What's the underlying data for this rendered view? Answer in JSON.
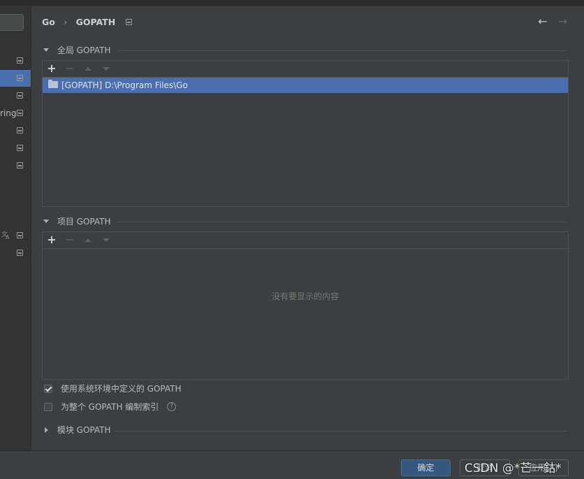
{
  "sidebar": {
    "items": [
      {
        "label": "",
        "selected": false
      },
      {
        "label": "",
        "selected": true
      },
      {
        "label": "",
        "selected": false
      },
      {
        "label": "ring",
        "selected": false
      },
      {
        "label": "",
        "selected": false
      },
      {
        "label": "",
        "selected": false
      },
      {
        "label": "",
        "selected": false
      }
    ],
    "extra_items": [
      {
        "icon": "translate-icon"
      },
      {
        "icon": "project-level-icon"
      }
    ]
  },
  "header": {
    "breadcrumb": [
      "Go",
      "GOPATH"
    ]
  },
  "global_section": {
    "title": "全局 GOPATH",
    "paths": [
      "[GOPATH] D:\\Program Files\\Go"
    ]
  },
  "project_section": {
    "title": "项目 GOPATH",
    "empty_text": "没有要显示的内容"
  },
  "options": {
    "use_system_env": {
      "label": "使用系统环境中定义的 GOPATH",
      "checked": true
    },
    "index_entire": {
      "label": "为整个 GOPATH 编制索引",
      "checked": false
    }
  },
  "module_section": {
    "title": "模块 GOPATH"
  },
  "buttons": {
    "ok": "确定",
    "cancel": "取消",
    "apply": "应用(A)"
  },
  "watermark": "CSDN @*芒一鈷*",
  "colors": {
    "selection": "#4b6eaf",
    "background": "#3c3f41",
    "primary_button": "#365880"
  }
}
